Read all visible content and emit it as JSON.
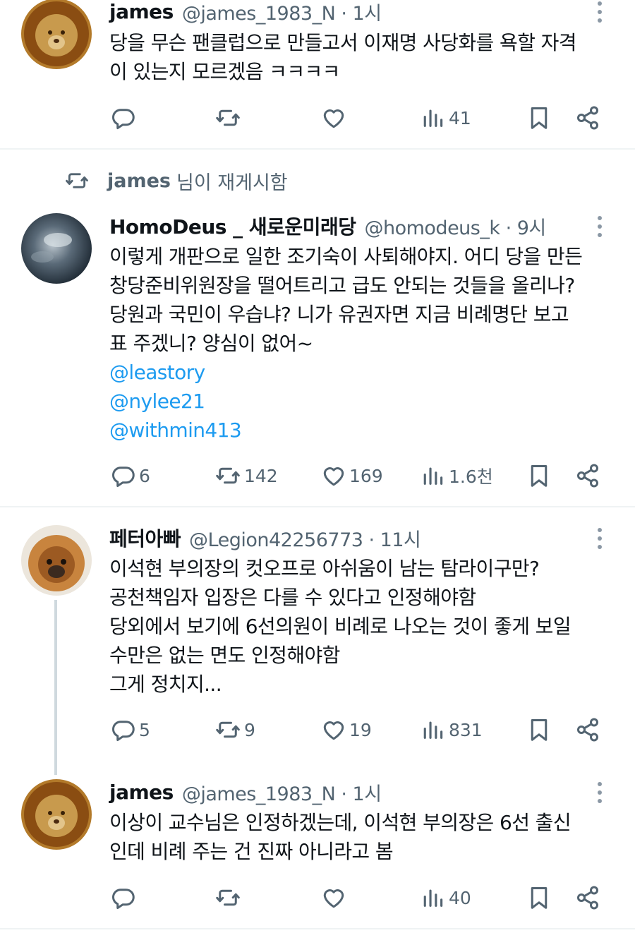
{
  "posts": [
    {
      "name": "james",
      "handle": "@james_1983_N · 1시",
      "lines": [
        "당을 무슨 팬클럽으로 만들고서 이재명 사당화를 욕할 자격",
        "이 있는지 모르겠음 ㅋㅋㅋㅋ"
      ],
      "mentions": [],
      "stats": {
        "replies": "",
        "reposts": "",
        "likes": "",
        "views": "41"
      }
    },
    {
      "name": "HomoDeus _ 새로운미래당",
      "handle": "@homodeus_k · 9시",
      "lines": [
        "이렇게 개판으로 일한 조기숙이 사퇴해야지. 어디 당을 만든",
        "창당준비위원장을 떨어트리고 급도 안되는 것들을 올리나?",
        "당원과 국민이 우습냐? 니가 유권자면 지금 비례명단 보고",
        "표 주겠니? 양심이 없어~"
      ],
      "mentions": [
        "@leastory",
        "@nylee21",
        "@withmin413"
      ],
      "stats": {
        "replies": "6",
        "reposts": "142",
        "likes": "169",
        "views": "1.6천"
      }
    },
    {
      "name": "페터아빠",
      "handle": "@Legion42256773 · 11시",
      "lines": [
        "이석현 부의장의 컷오프로 아쉬움이 남는 탐라이구만?",
        "공천책임자 입장은 다를 수 있다고 인정해야함",
        "당외에서 보기에 6선의원이 비례로 나오는 것이 좋게 보일",
        "수만은 없는 면도 인정해야함",
        "그게 정치지..."
      ],
      "mentions": [],
      "stats": {
        "replies": "5",
        "reposts": "9",
        "likes": "19",
        "views": "831"
      }
    },
    {
      "name": "james",
      "handle": "@james_1983_N · 1시",
      "lines": [
        "이상이 교수님은 인정하겠는데, 이석현 부의장은 6선 출신",
        "인데 비례 주는 건 진짜 아니라고 봄"
      ],
      "mentions": [],
      "stats": {
        "replies": "",
        "reposts": "",
        "likes": "",
        "views": "40"
      }
    }
  ],
  "repost_note": {
    "name": "james",
    "text": "님이 재게시함"
  },
  "colors": {
    "mention": "#1d9bf0",
    "secondary": "#536471",
    "divider": "#eff3f4"
  },
  "icons": [
    "reply-icon",
    "repost-icon",
    "like-icon",
    "views-icon",
    "bookmark-icon",
    "share-icon",
    "more-icon"
  ]
}
